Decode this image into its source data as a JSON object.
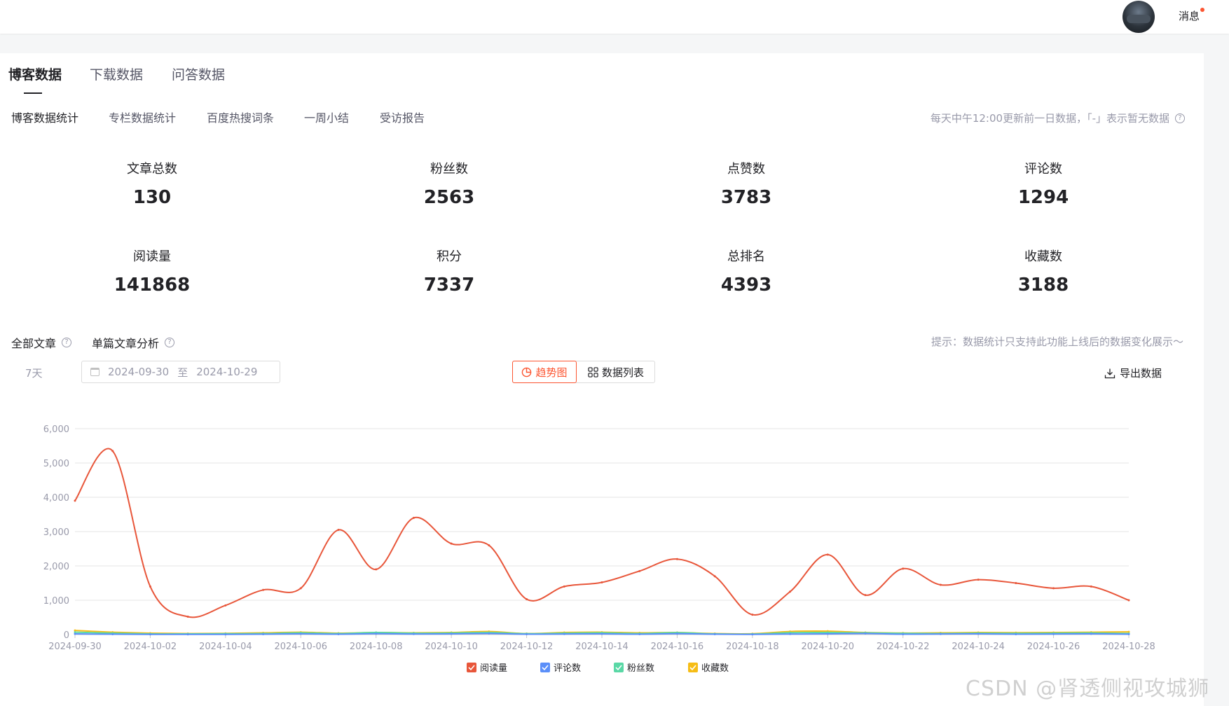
{
  "header": {
    "messages_label": "消息",
    "avatar_icon": "user-avatar"
  },
  "tabs": [
    "博客数据",
    "下载数据",
    "问答数据"
  ],
  "subtabs": [
    "博客数据统计",
    "专栏数据统计",
    "百度热搜词条",
    "一周小结",
    "受访报告"
  ],
  "notice": "每天中午12:00更新前一日数据，「-」表示暂无数据",
  "stats": [
    {
      "label": "文章总数",
      "value": "130"
    },
    {
      "label": "粉丝数",
      "value": "2563"
    },
    {
      "label": "点赞数",
      "value": "3783"
    },
    {
      "label": "评论数",
      "value": "1294"
    },
    {
      "label": "阅读量",
      "value": "141868"
    },
    {
      "label": "积分",
      "value": "7337"
    },
    {
      "label": "总排名",
      "value": "4393"
    },
    {
      "label": "收藏数",
      "value": "3188"
    }
  ],
  "filters": {
    "all_articles": "全部文章",
    "single_analysis": "单篇文章分析",
    "hint": "提示：数据统计只支持此功能上线后的数据变化展示～"
  },
  "range": {
    "label": "7天",
    "start": "2024-09-30",
    "sep": "至",
    "end": "2024-10-29"
  },
  "view_toggle": {
    "trend": "趋势图",
    "list": "数据列表"
  },
  "export_label": "导出数据",
  "watermark": "CSDN @肾透侧视攻城狮",
  "chart_data": {
    "type": "line",
    "x": [
      "2024-09-30",
      "2024-10-01",
      "2024-10-02",
      "2024-10-03",
      "2024-10-04",
      "2024-10-05",
      "2024-10-06",
      "2024-10-07",
      "2024-10-08",
      "2024-10-09",
      "2024-10-10",
      "2024-10-11",
      "2024-10-12",
      "2024-10-13",
      "2024-10-14",
      "2024-10-15",
      "2024-10-16",
      "2024-10-17",
      "2024-10-18",
      "2024-10-19",
      "2024-10-20",
      "2024-10-21",
      "2024-10-22",
      "2024-10-23",
      "2024-10-24",
      "2024-10-25",
      "2024-10-26",
      "2024-10-27",
      "2024-10-28"
    ],
    "xticks": [
      "2024-09-30",
      "2024-10-02",
      "2024-10-04",
      "2024-10-06",
      "2024-10-08",
      "2024-10-10",
      "2024-10-12",
      "2024-10-14",
      "2024-10-16",
      "2024-10-18",
      "2024-10-20",
      "2024-10-22",
      "2024-10-24",
      "2024-10-26",
      "2024-10-28"
    ],
    "ylim": [
      0,
      6000
    ],
    "yticks": [
      "0",
      "1,000",
      "2,000",
      "3,000",
      "4,000",
      "5,000",
      "6,000"
    ],
    "legend_position": "bottom",
    "grid": true,
    "series": [
      {
        "name": "阅读量",
        "color": "#e8563a",
        "values": [
          3900,
          5350,
          1400,
          520,
          850,
          1300,
          1350,
          3050,
          1900,
          3400,
          2650,
          2600,
          1030,
          1400,
          1520,
          1850,
          2200,
          1700,
          580,
          1250,
          2330,
          1150,
          1920,
          1450,
          1600,
          1500,
          1350,
          1400,
          1000
        ]
      },
      {
        "name": "评论数",
        "color": "#5b8ff9",
        "values": [
          20,
          10,
          5,
          5,
          5,
          10,
          20,
          10,
          25,
          15,
          20,
          30,
          10,
          15,
          20,
          10,
          25,
          10,
          5,
          15,
          20,
          30,
          10,
          15,
          20,
          10,
          15,
          20,
          10
        ]
      },
      {
        "name": "粉丝数",
        "color": "#5ad8a6",
        "values": [
          70,
          40,
          20,
          20,
          25,
          30,
          50,
          30,
          60,
          40,
          45,
          60,
          25,
          40,
          50,
          30,
          55,
          20,
          15,
          55,
          60,
          50,
          35,
          30,
          40,
          35,
          40,
          45,
          30
        ]
      },
      {
        "name": "收藏数",
        "color": "#f6bd16",
        "values": [
          120,
          70,
          40,
          30,
          35,
          50,
          70,
          40,
          60,
          50,
          60,
          90,
          30,
          60,
          70,
          50,
          60,
          30,
          25,
          90,
          100,
          60,
          45,
          50,
          60,
          55,
          60,
          70,
          80
        ]
      }
    ]
  }
}
